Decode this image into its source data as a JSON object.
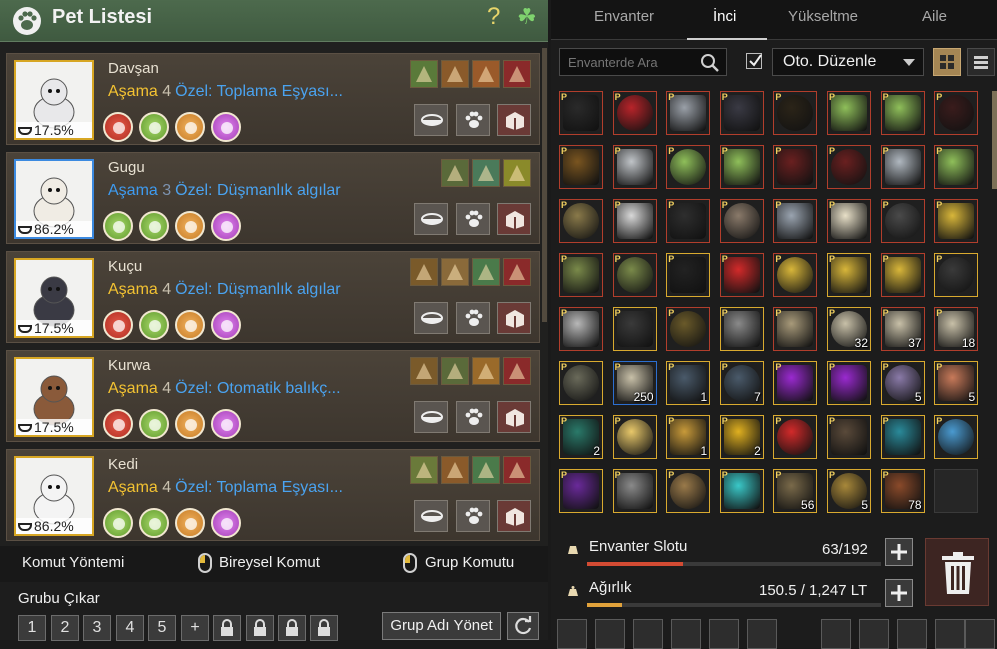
{
  "left_panel": {
    "title": "Pet Listesi",
    "help": "?",
    "clover": "☘"
  },
  "pets": [
    {
      "name": "Davşan",
      "stage_label": "Aşama",
      "stage": "4",
      "special": "Özel: Toplama Eşyası...",
      "hunger": "17.5%",
      "frame": "gold",
      "stage_color": "gold"
    },
    {
      "name": "Gugu",
      "stage_label": "Aşama",
      "stage": "3",
      "special": "Özel: Düşmanlık algılar",
      "hunger": "86.2%",
      "frame": "blue",
      "stage_color": "blue"
    },
    {
      "name": "Kuçu",
      "stage_label": "Aşama",
      "stage": "4",
      "special": "Özel: Düşmanlık algılar",
      "hunger": "17.5%",
      "frame": "gold",
      "stage_color": "gold"
    },
    {
      "name": "Kurwa",
      "stage_label": "Aşama",
      "stage": "4",
      "special": "Özel: Otomatik balıkç...",
      "hunger": "17.5%",
      "frame": "gold",
      "stage_color": "gold"
    },
    {
      "name": "Kedi",
      "stage_label": "Aşama",
      "stage": "4",
      "special": "Özel: Toplama Eşyası...",
      "hunger": "86.2%",
      "frame": "gold",
      "stage_color": "gold"
    }
  ],
  "commands": {
    "method": "Komut Yöntemi",
    "individual": "Bireysel Komut",
    "group": "Grup Komutu",
    "remove_group": "Grubu Çıkar",
    "group_buttons": [
      "1",
      "2",
      "3",
      "4",
      "5",
      "+"
    ],
    "manage_group_name": "Grup Adı Yönet"
  },
  "inventory": {
    "tabs": [
      "Envanter",
      "İnci",
      "Yükseltme",
      "Aile"
    ],
    "active_tab": "İnci",
    "search_placeholder": "Envanterde Ara",
    "auto_sort_label": "Oto. Düzenle",
    "auto_sort_checked": true,
    "slot_label": "Envanter Slotu",
    "slot_used": 63,
    "slot_total": 192,
    "slot_value": "63/192",
    "weight_label": "Ağırlık",
    "weight_value": "150.5 / 1,247 LT",
    "weight_current": 150.5,
    "weight_max": 1247,
    "items": [
      {
        "c": "#2a2a2a",
        "n": ""
      },
      {
        "c": "#b8242a",
        "n": ""
      },
      {
        "c": "#9aa0a8",
        "n": ""
      },
      {
        "c": "#3a3a44",
        "n": ""
      },
      {
        "c": "#2b2418",
        "n": ""
      },
      {
        "c": "#8fbf5a",
        "n": ""
      },
      {
        "c": "#8fbf5a",
        "n": ""
      },
      {
        "c": "#3a1c1c",
        "n": ""
      },
      {
        "c": "#7a5520",
        "n": ""
      },
      {
        "c": "#c0c4c8",
        "n": ""
      },
      {
        "c": "#8fbf5a",
        "n": ""
      },
      {
        "c": "#8fbf5a",
        "n": ""
      },
      {
        "c": "#6a2020",
        "n": ""
      },
      {
        "c": "#6a2020",
        "n": ""
      },
      {
        "c": "#b0b8c0",
        "n": ""
      },
      {
        "c": "#8fbf5a",
        "n": ""
      },
      {
        "c": "#8a7a4a",
        "n": ""
      },
      {
        "c": "#d8d8d8",
        "n": ""
      },
      {
        "c": "#2e2e2e",
        "n": ""
      },
      {
        "c": "#8a7a6a",
        "n": ""
      },
      {
        "c": "#9aa4b0",
        "n": ""
      },
      {
        "c": "#e8e0c8",
        "n": ""
      },
      {
        "c": "#4a4a4a",
        "n": ""
      },
      {
        "c": "#d8b63a",
        "n": ""
      },
      {
        "c": "#7a8a4a",
        "n": ""
      },
      {
        "c": "#7a8a4a",
        "n": ""
      },
      {
        "c": "#222222",
        "n": ""
      },
      {
        "c": "#d22a2a",
        "n": ""
      },
      {
        "c": "#d8b63a",
        "n": ""
      },
      {
        "c": "#d8b63a",
        "n": ""
      },
      {
        "c": "#d8b63a",
        "n": ""
      },
      {
        "c": "#3a3a3a",
        "n": ""
      },
      {
        "c": "#b8b8b8",
        "n": ""
      },
      {
        "c": "#3a3a3a",
        "n": ""
      },
      {
        "c": "#6a5a2a",
        "n": ""
      },
      {
        "c": "#8a8a8a",
        "n": ""
      },
      {
        "c": "#a89a7a",
        "n": ""
      },
      {
        "c": "#c8c0a8",
        "n": "32"
      },
      {
        "c": "#c8c0a8",
        "n": "37"
      },
      {
        "c": "#c8c0a8",
        "n": "18"
      },
      {
        "c": "#6a6a5a",
        "n": ""
      },
      {
        "c": "#c8c0a8",
        "n": "250"
      },
      {
        "c": "#4a5a6a",
        "n": "1"
      },
      {
        "c": "#4a5a6a",
        "n": "7"
      },
      {
        "c": "#9a2ad0",
        "n": ""
      },
      {
        "c": "#9a2ad0",
        "n": ""
      },
      {
        "c": "#8a7aa8",
        "n": "5"
      },
      {
        "c": "#c87a5a",
        "n": "5"
      },
      {
        "c": "#2a7a6a",
        "n": "2"
      },
      {
        "c": "#e8c86a",
        "n": ""
      },
      {
        "c": "#c89a3a",
        "n": "1"
      },
      {
        "c": "#e0b020",
        "n": "2"
      },
      {
        "c": "#d22a2a",
        "n": ""
      },
      {
        "c": "#5a4a3a",
        "n": ""
      },
      {
        "c": "#2a8a9a",
        "n": ""
      },
      {
        "c": "#4a9ad0",
        "n": ""
      },
      {
        "c": "#6a2a9a",
        "n": ""
      },
      {
        "c": "#8a8a8a",
        "n": ""
      },
      {
        "c": "#9a7a4a",
        "n": ""
      },
      {
        "c": "#3ac8c8",
        "n": ""
      },
      {
        "c": "#7a6a4a",
        "n": "56"
      },
      {
        "c": "#a8883a",
        "n": "5"
      },
      {
        "c": "#8a4a2a",
        "n": "78"
      },
      {
        "c": "",
        "n": ""
      }
    ]
  },
  "colors": {
    "gold_frame": "#d7a623",
    "blue_frame": "#3c8ae0",
    "header_green": "#4d6a4d",
    "stage_gold": "#f3c232",
    "special_blue": "#4aa3f0"
  }
}
